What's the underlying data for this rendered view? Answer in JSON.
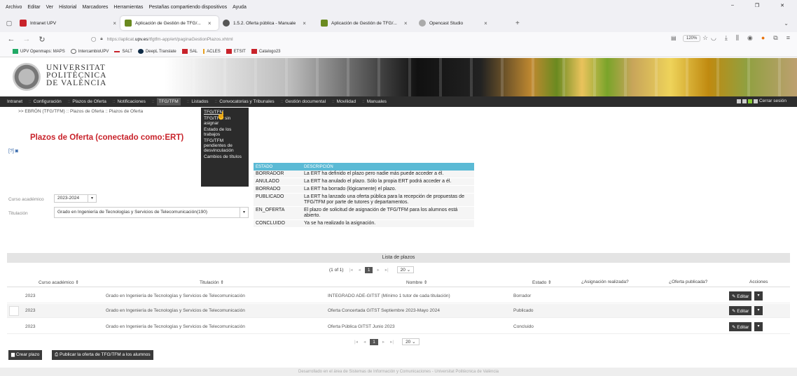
{
  "browser": {
    "menu": [
      "Archivo",
      "Editar",
      "Ver",
      "Historial",
      "Marcadores",
      "Herramientas",
      "Pestañas compartiendo dispositivos",
      "Ayuda"
    ],
    "tabs": [
      {
        "label": "Intranet UPV",
        "color": "#c8222a",
        "active": false
      },
      {
        "label": "Aplicación de Gestión de TFG/...",
        "color": "#6a8a20",
        "active": true
      },
      {
        "label": "1.5.2. Oferta pública - Manuale",
        "color": "#555555",
        "active": false
      },
      {
        "label": "Aplicación de Gestión de TFG/...",
        "color": "#6a8a20",
        "active": false
      },
      {
        "label": "Opencast Studio",
        "color": "#999999",
        "active": false
      }
    ],
    "url_prefix": "https://aplicat.",
    "url_domain": "upv.es",
    "url_path": "/tfgtfm-app/ert/paginaGestionPlazos.xhtml",
    "zoom": "120%",
    "bookmarks": [
      "UPV Openmaps: MAPS",
      "IntercambioUPV",
      "SALT",
      "DeepL Translate",
      "SAL",
      "ACLES",
      "ETSIT",
      "Catalogo23"
    ]
  },
  "header": {
    "uni_line1": "UNIVERSITAT",
    "uni_line2": "POLITÈCNICA",
    "uni_line3": "DE VALÈNCIA"
  },
  "mainmenu": {
    "items": [
      "Intranet",
      "Configuración",
      "Plazos de Oferta",
      "Notificaciones",
      "TFG/TFM",
      "Listados",
      "Convocatorias y Tribunales",
      "Gestión documental",
      "Movilidad",
      "Manuales"
    ],
    "logout": "Cerrar sesión"
  },
  "breadcrumb": ">> EBRÓN (TFG/TFM) :: Plazos de Oferta :: Plazos de Oferta",
  "page_title": "Plazos de Oferta (conectado como:ERT)",
  "dropdown": [
    "TFG/TFM",
    "TFG/TFM sin asignar",
    "Estado de los trabajos",
    "TFG/TFM pendientes de desvinculación",
    "Cambios de títulos"
  ],
  "legend": {
    "col_estado": "ESTADO",
    "col_desc": "DESCRIPCIÓN",
    "rows": [
      {
        "k": "BORRADOR",
        "v": "La ERT ha definido el plazo pero nadie más puede acceder a él."
      },
      {
        "k": "ANULADO",
        "v": "La ERT ha anulado el plazo. Sólo la propia ERT podrá acceder a él."
      },
      {
        "k": "BORRADO",
        "v": "La ERT ha borrado (lógicamente) el plazo."
      },
      {
        "k": "PUBLICADO",
        "v": "La ERT ha lanzado una oferta pública para la recepción de propuestas de TFG/TFM por parte de tutores y departamentos."
      },
      {
        "k": "EN_OFERTA",
        "v": "El plazo de solicitud de asignación de TFG/TFM para los alumnos está abierto."
      },
      {
        "k": "CONCLUIDO",
        "v": "Ya se ha realizado la asignación."
      }
    ]
  },
  "form": {
    "curso_label": "Curso académico",
    "curso_value": "2023-2024",
    "titulacion_label": "Titulación",
    "titulacion_value": "Grado en Ingeniería de Tecnologías y Servicios de Telecomunicación(190)"
  },
  "lista": {
    "title": "Lista de plazos",
    "page_info": "(1 of 1)",
    "page": "1",
    "per_page": "20",
    "columns": [
      "Curso académico ⇕",
      "Titulación ⇕",
      "Nombre ⇕",
      "Estado ⇕",
      "¿Asignación realizada?",
      "¿Oferta publicada?",
      "Acciones"
    ],
    "rows": [
      {
        "curso": "2023",
        "titulacion": "Grado en Ingeniería de Tecnologías y Servicios de Telecomunicación",
        "nombre": "INTEGRADO ADE-GITST (Mínimo 1 tutor de cada titulación)",
        "estado": "Borrador"
      },
      {
        "curso": "2023",
        "titulacion": "Grado en Ingeniería de Tecnologías y Servicios de Telecomunicación",
        "nombre": "Oferta Concertada GITST Septiembre 2023-Mayo 2024",
        "estado": "Publicado"
      },
      {
        "curso": "2023",
        "titulacion": "Grado en Ingeniería de Tecnologías y Servicios de Telecomunicación",
        "nombre": "Oferta Pública GITST Junio 2023",
        "estado": "Concluido"
      }
    ],
    "edit_label": "Editar"
  },
  "buttons": {
    "crear": "Crear plazo",
    "publicar": "Publicar la oferta de TFG/TFM a los alumnos"
  },
  "footer": "Desarrollado en el área de Sistemas de Información y Comunicaciones - Universitat Politècnica de València"
}
